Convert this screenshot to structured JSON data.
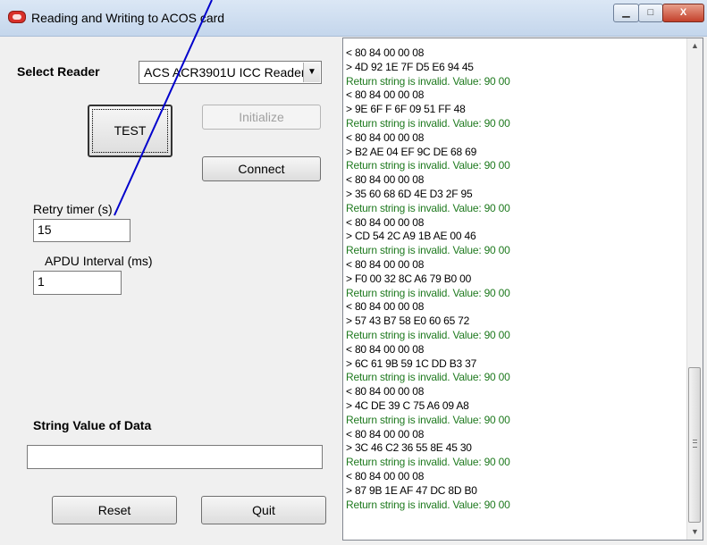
{
  "window": {
    "title": "Reading and Writing to ACOS card",
    "minimize_glyph": "▁",
    "maximize_glyph": "□",
    "close_glyph": "X"
  },
  "reader": {
    "label": "Select Reader",
    "selected": "ACS ACR3901U ICC Reader"
  },
  "buttons": {
    "test": "TEST",
    "initialize": "Initialize",
    "connect": "Connect",
    "reset": "Reset",
    "quit": "Quit"
  },
  "retry": {
    "label": "Retry timer (s)",
    "value": "15"
  },
  "apdu": {
    "label": "APDU Interval (ms)",
    "value": "1"
  },
  "string_value": {
    "label": "String Value of Data",
    "value": ""
  },
  "log": {
    "lines": [
      {
        "kind": "cmd",
        "text": "< 80 84 00 00 08"
      },
      {
        "kind": "resp",
        "text": "> 4D 92 1E 7F D5 E6 94 45"
      },
      {
        "kind": "msg",
        "text": "Return string is invalid. Value: 90 00"
      },
      {
        "kind": "cmd",
        "text": "< 80 84 00 00 08"
      },
      {
        "kind": "resp",
        "text": "> 9E 6F F 6F 09 51 FF 48"
      },
      {
        "kind": "msg",
        "text": "Return string is invalid. Value: 90 00"
      },
      {
        "kind": "cmd",
        "text": "< 80 84 00 00 08"
      },
      {
        "kind": "resp",
        "text": "> B2 AE 04 EF 9C DE 68 69"
      },
      {
        "kind": "msg",
        "text": "Return string is invalid. Value: 90 00"
      },
      {
        "kind": "cmd",
        "text": "< 80 84 00 00 08"
      },
      {
        "kind": "resp",
        "text": "> 35 60 68 6D 4E D3 2F 95"
      },
      {
        "kind": "msg",
        "text": "Return string is invalid. Value: 90 00"
      },
      {
        "kind": "cmd",
        "text": "< 80 84 00 00 08"
      },
      {
        "kind": "resp",
        "text": "> CD 54 2C A9 1B AE 00 46"
      },
      {
        "kind": "msg",
        "text": "Return string is invalid. Value: 90 00"
      },
      {
        "kind": "cmd",
        "text": "< 80 84 00 00 08"
      },
      {
        "kind": "resp",
        "text": "> F0 00 32 8C A6 79 B0 00"
      },
      {
        "kind": "msg",
        "text": "Return string is invalid. Value: 90 00"
      },
      {
        "kind": "cmd",
        "text": "< 80 84 00 00 08"
      },
      {
        "kind": "resp",
        "text": "> 57 43 B7 58 E0 60 65 72"
      },
      {
        "kind": "msg",
        "text": "Return string is invalid. Value: 90 00"
      },
      {
        "kind": "cmd",
        "text": "< 80 84 00 00 08"
      },
      {
        "kind": "resp",
        "text": "> 6C 61 9B 59 1C DD B3 37"
      },
      {
        "kind": "msg",
        "text": "Return string is invalid. Value: 90 00"
      },
      {
        "kind": "cmd",
        "text": "< 80 84 00 00 08"
      },
      {
        "kind": "resp",
        "text": "> 4C DE 39 C 75 A6 09 A8"
      },
      {
        "kind": "msg",
        "text": "Return string is invalid. Value: 90 00"
      },
      {
        "kind": "cmd",
        "text": "< 80 84 00 00 08"
      },
      {
        "kind": "resp",
        "text": "> 3C 46 C2 36 55 8E 45 30"
      },
      {
        "kind": "msg",
        "text": "Return string is invalid. Value: 90 00"
      },
      {
        "kind": "cmd",
        "text": "< 80 84 00 00 08"
      },
      {
        "kind": "resp",
        "text": "> 87 9B 1E AF 47 DC 8D B0"
      },
      {
        "kind": "msg",
        "text": "Return string is invalid. Value: 90 00"
      }
    ],
    "scroll_up_glyph": "▲",
    "scroll_down_glyph": "▼"
  },
  "colors": {
    "message_text": "#1f7a1f",
    "annotation_line": "#0000cc"
  }
}
